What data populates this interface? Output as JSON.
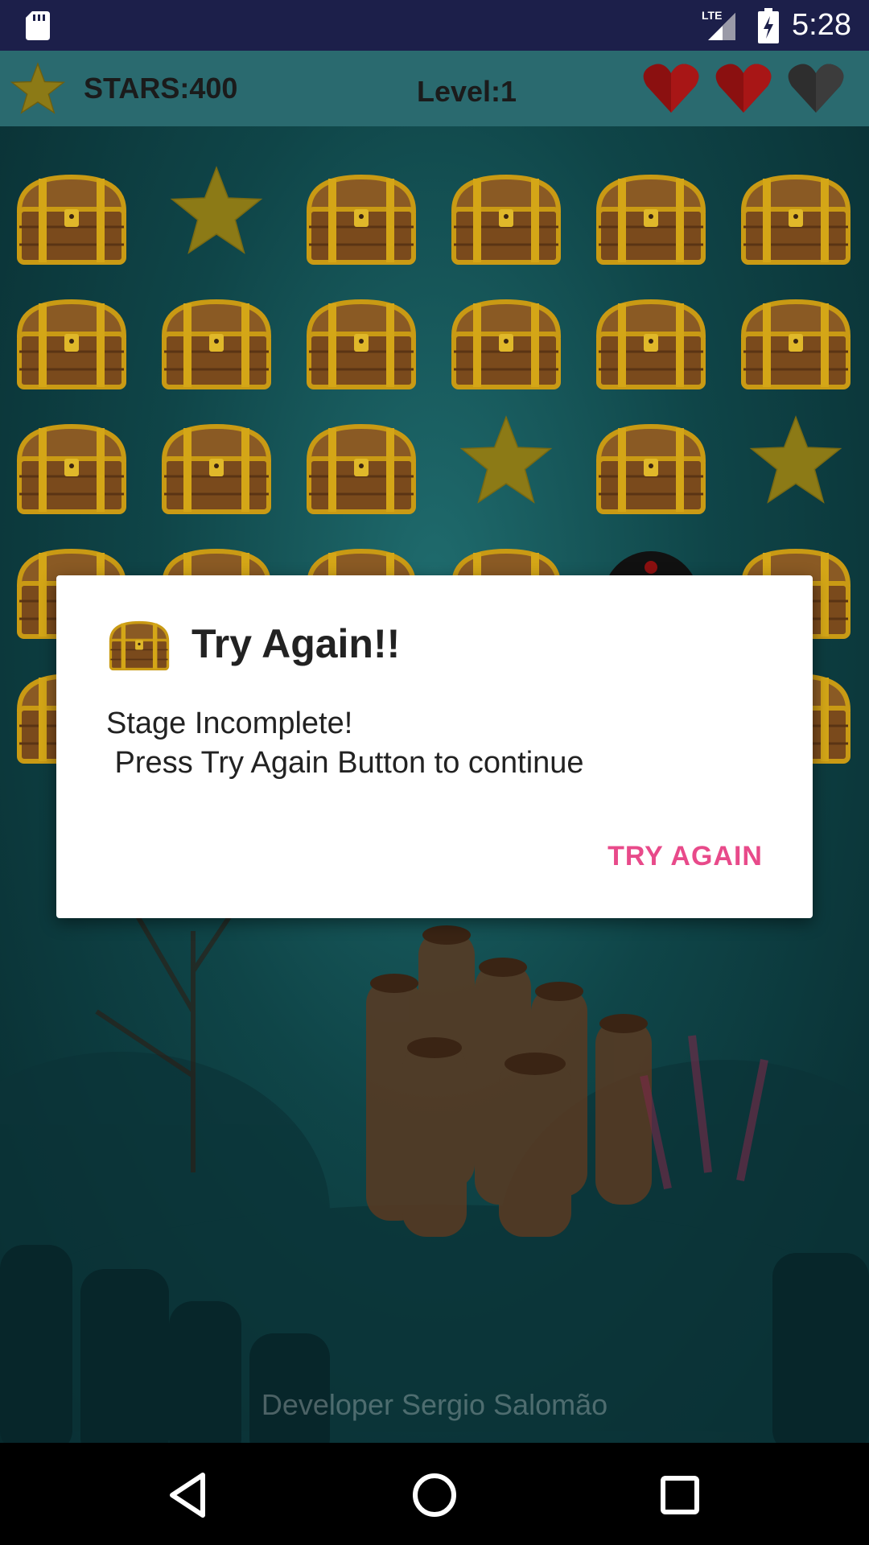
{
  "status_bar": {
    "time": "5:28",
    "network": "LTE"
  },
  "header": {
    "stars_label": "STARS:400",
    "level_label": "Level:1",
    "hearts": [
      "full",
      "full",
      "empty"
    ]
  },
  "grid": {
    "rows": [
      [
        "chest",
        "star",
        "chest",
        "chest",
        "chest",
        "chest"
      ],
      [
        "chest",
        "chest",
        "chest",
        "chest",
        "chest",
        "chest"
      ],
      [
        "chest",
        "chest",
        "chest",
        "star",
        "chest",
        "star"
      ],
      [
        "chest",
        "chest",
        "chest",
        "chest",
        "bomb",
        "chest"
      ],
      [
        "chest",
        "",
        "",
        "",
        "",
        "chest"
      ]
    ]
  },
  "dialog": {
    "title": "Try Again!!",
    "message": "Stage Incomplete!\n Press Try Again Button to continue",
    "button_label": "TRY AGAIN"
  },
  "footer": {
    "developer": "Developer Sergio Salomão"
  },
  "colors": {
    "accent": "#e84a8a",
    "status_bar": "#1c1f4a",
    "header": "#2a6a6f",
    "star": "#8c7a16",
    "heart": "#8b1010"
  }
}
